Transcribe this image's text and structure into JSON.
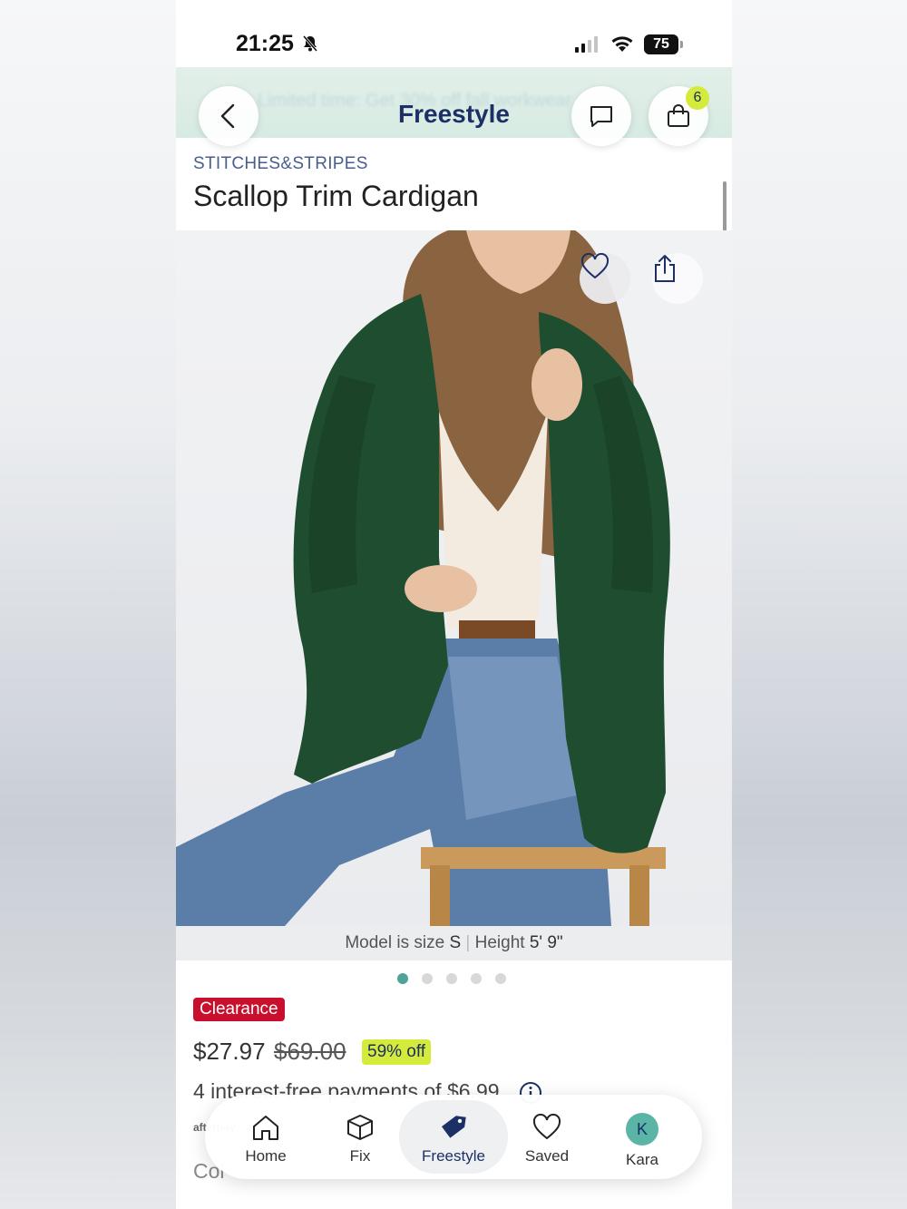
{
  "status_bar": {
    "time": "21:25",
    "battery": "75"
  },
  "header": {
    "promo_text": "Limited time: Get 30% off fall workwear",
    "title": "Freestyle",
    "cart_count": "6"
  },
  "product": {
    "brand": "STITCHES&STRIPES",
    "name": "Scallop Trim Cardigan",
    "model_size_label": "Model is size",
    "model_size": "S",
    "height_label": "Height",
    "height": "5' 9\"",
    "badge": "Clearance",
    "price": "$27.97",
    "original_price": "$69.00",
    "discount": "59% off",
    "installments": "4 interest-free payments of $6.99",
    "payment_brand": "afterpay",
    "color_label": "Col"
  },
  "carousel": {
    "total": 5,
    "active": 0
  },
  "tab_bar": {
    "tabs": [
      {
        "label": "Home",
        "icon": "home-icon"
      },
      {
        "label": "Fix",
        "icon": "box-icon"
      },
      {
        "label": "Freestyle",
        "icon": "tag-icon"
      },
      {
        "label": "Saved",
        "icon": "heart-icon"
      },
      {
        "label": "Kara",
        "icon": "avatar",
        "initial": "K"
      }
    ]
  },
  "colors": {
    "brand_navy": "#1c2f66",
    "accent_lime": "#d5eb3b",
    "clearance_red": "#c8102e",
    "teal": "#4fa39b",
    "cardigan_green": "#1f4d2f"
  }
}
